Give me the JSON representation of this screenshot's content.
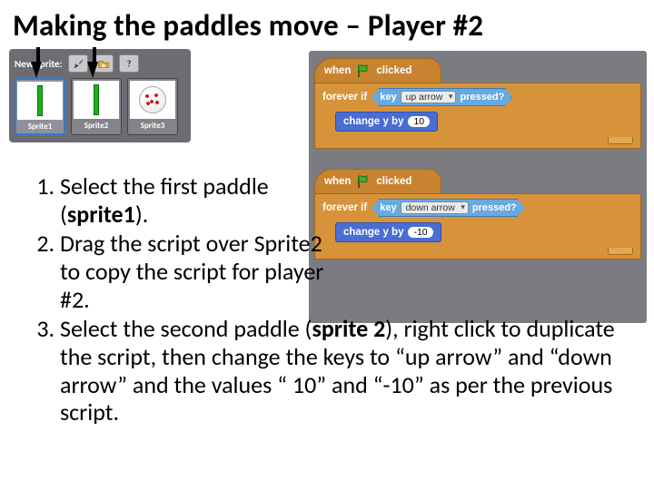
{
  "title": "Making the paddles move – Player #2",
  "sprite_panel": {
    "header": "New sprite:",
    "sprites": [
      {
        "name": "Sprite1"
      },
      {
        "name": "Sprite2"
      },
      {
        "name": "Sprite3"
      }
    ]
  },
  "scripts": [
    {
      "hat_prefix": "when",
      "hat_suffix": "clicked",
      "forever_label": "forever if",
      "key_label_pre": "key",
      "key_value": "up arrow",
      "key_label_post": "pressed?",
      "motion_label": "change y by",
      "motion_value": "10"
    },
    {
      "hat_prefix": "when",
      "hat_suffix": "clicked",
      "forever_label": "forever if",
      "key_label_pre": "key",
      "key_value": "down arrow",
      "key_label_post": "pressed?",
      "motion_label": "change y by",
      "motion_value": "-10"
    }
  ],
  "steps": {
    "s1_a": "Select the first paddle (",
    "s1_b": "sprite1",
    "s1_c": ").",
    "s2": "Drag the script over Sprite2 to copy the script for player #2.",
    "s3_a": "Select the second paddle (",
    "s3_b": "sprite 2",
    "s3_c": "), right click to duplicate the script, then change the keys to “up arrow” and “down arrow” and the values “ 10” and “-10” as per the previous script."
  }
}
